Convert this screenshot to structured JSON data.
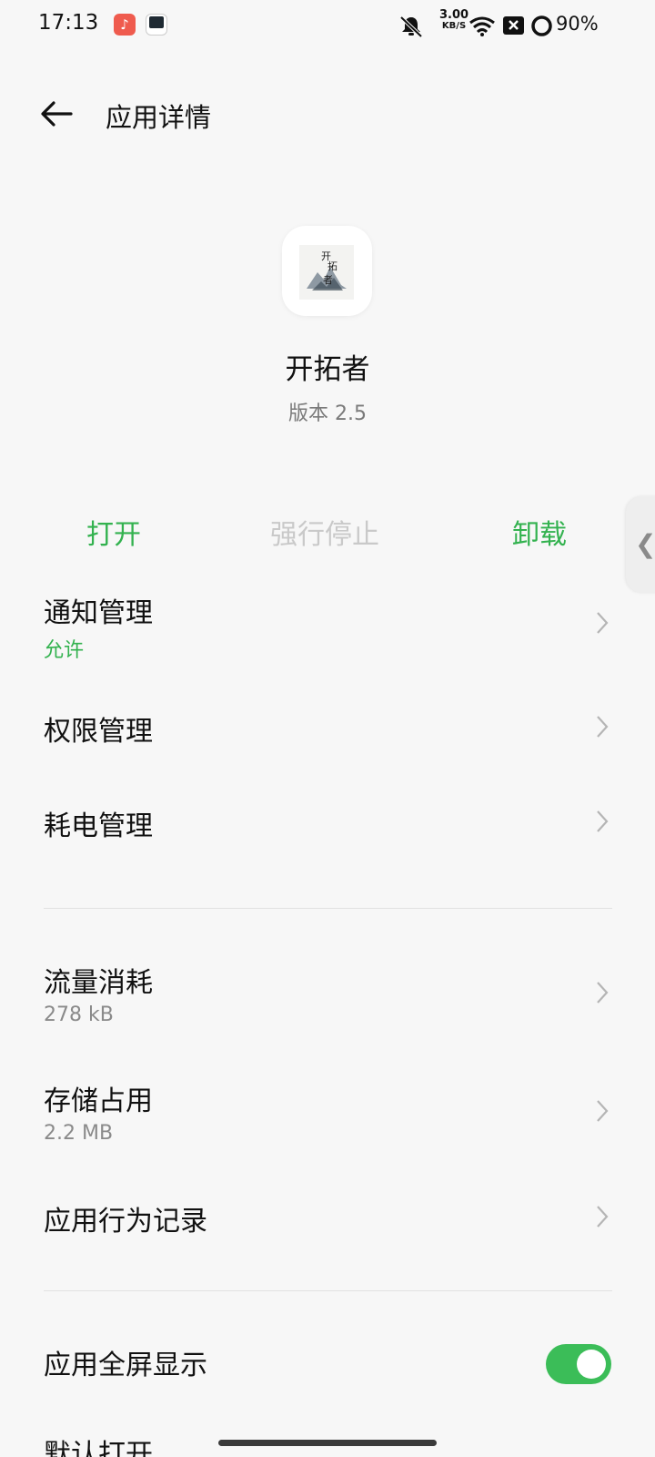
{
  "status_bar": {
    "time": "17:13",
    "network_speed_value": "3.00",
    "network_speed_unit": "KB/S",
    "battery": "90%",
    "icons": [
      "music-app-icon",
      "reader-app-icon",
      "mute-bell-icon",
      "wifi-icon",
      "sim-off-icon",
      "battery-ring-icon"
    ]
  },
  "header": {
    "title": "应用详情",
    "back_icon": "arrow-left-icon"
  },
  "app": {
    "name": "开拓者",
    "version": "版本 2.5"
  },
  "actions": {
    "open": "打开",
    "force_stop": "强行停止",
    "uninstall": "卸载"
  },
  "side_handle": {
    "glyph": "❮"
  },
  "rows": {
    "notification": {
      "title": "通知管理",
      "sub": "允许"
    },
    "permission": {
      "title": "权限管理"
    },
    "power": {
      "title": "耗电管理"
    },
    "data_usage": {
      "title": "流量消耗",
      "sub": "278 kB"
    },
    "storage": {
      "title": "存储占用",
      "sub": "2.2 MB"
    },
    "behavior": {
      "title": "应用行为记录"
    },
    "fullscreen": {
      "title": "应用全屏显示",
      "toggle_on": true
    },
    "default_open": {
      "title": "默认打开"
    }
  },
  "colors": {
    "accent_green": "#33b24f",
    "toggle_green": "#3bbd58",
    "disabled_gray": "#c9c9c9",
    "background": "#f7f7f7"
  }
}
